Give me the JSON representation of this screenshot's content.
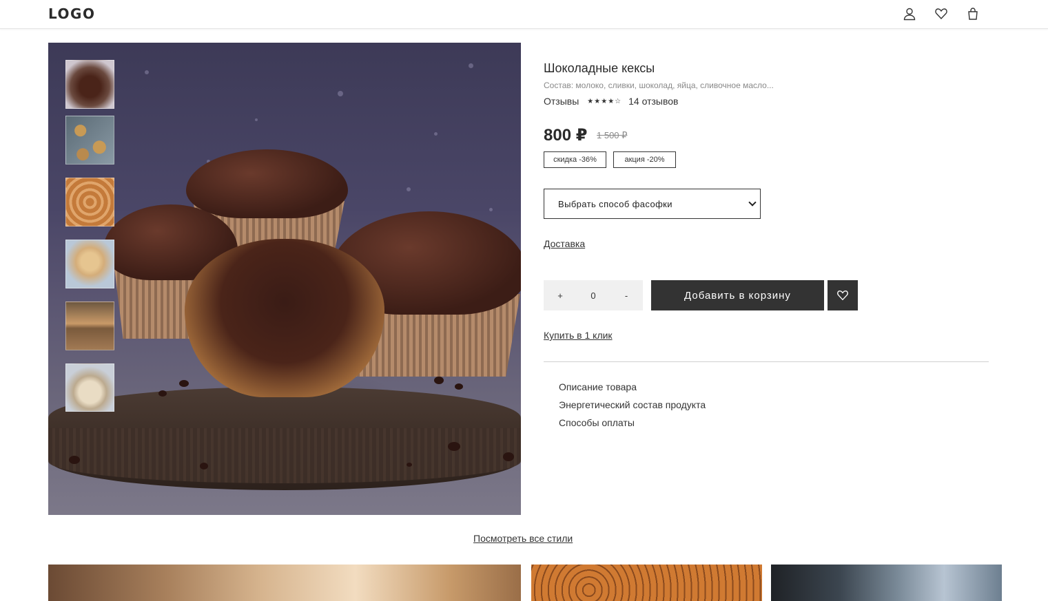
{
  "header": {
    "logo": "LOGO",
    "icons": [
      "user-icon",
      "heart-icon",
      "bag-icon"
    ]
  },
  "product": {
    "title": "Шоколадные кексы",
    "composition": "Состав: молоко, сливки, шоколад, яйца, сливочное масло...",
    "reviews_label": "Отзывы",
    "rating": 4,
    "rating_max": 5,
    "stars": "★★★★☆",
    "review_count": "14 отзывов",
    "price": "800 ₽",
    "old_price": "1 500 ₽",
    "tags": [
      "скидка -36%",
      "акция -20%"
    ],
    "select_placeholder": "Выбрать способ фасофки",
    "delivery_link": "Доставка",
    "quantity": {
      "plus": "+",
      "value": "0",
      "minus": "-"
    },
    "add_to_cart": "Добавить в корзину",
    "buy_one_click": "Купить в 1 клик",
    "info_sections": [
      "Описание товара",
      "Энергетический состав продукта",
      "Способы оплаты"
    ]
  },
  "gallery": {
    "thumbnails": [
      "cupcakes-thumb",
      "cookies-thumb",
      "buns-thumb",
      "blueberry-cookies-thumb",
      "strudel-thumb",
      "cookies-plate-thumb"
    ]
  },
  "view_all": "Посмотреть все стили",
  "colors": {
    "accent": "#333333",
    "text": "#2a2a2a",
    "muted": "#888888",
    "stepper_bg": "#f0f0f0"
  }
}
